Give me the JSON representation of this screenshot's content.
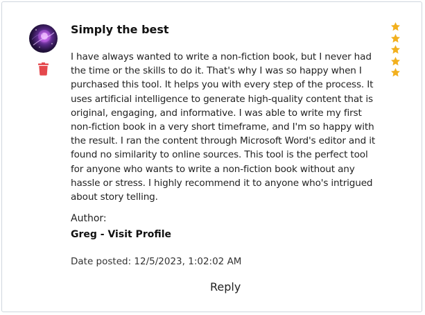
{
  "review": {
    "title": "Simply the best",
    "rating": 5,
    "rating_max": 5,
    "body": "I have always wanted to write a non-fiction book, but I never had the time or the skills to do it. That's why I was so happy when I purchased this tool. It helps you with every step of the process. It uses artificial intelligence to generate high-quality content that is original, engaging, and informative. I was able to write my first non-fiction book in a very short timeframe, and I'm so happy with the result. I ran the content through Microsoft Word's editor and it found no similarity to online sources. This tool is the perfect tool for anyone who wants to write a non-fiction book without any hassle or stress. I highly recommend it to anyone who's intrigued about story telling.",
    "author_label": "Author:",
    "author_link": "Greg - Visit Profile",
    "date_posted": "Date posted: 12/5/2023, 1:02:02 AM",
    "reply_label": "Reply"
  },
  "icons": {
    "avatar": "avatar-image",
    "delete": "trash-icon",
    "star": "star-icon"
  },
  "colors": {
    "star": "#f2b01e",
    "delete": "#e5484d",
    "card_border": "#d0d6de"
  }
}
